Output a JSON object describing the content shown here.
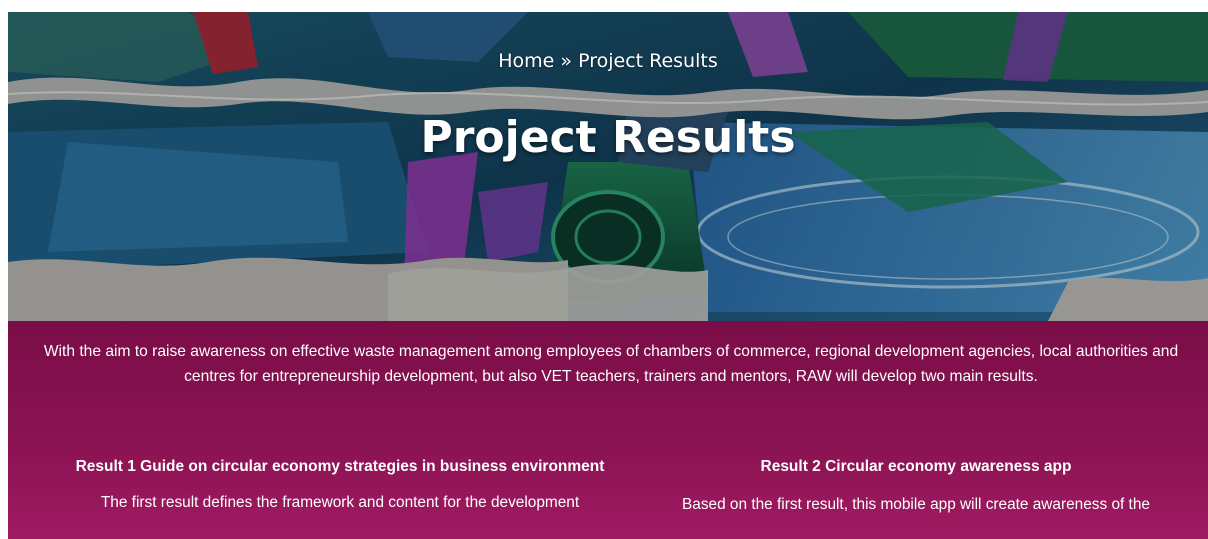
{
  "hero": {
    "breadcrumb": {
      "home": "Home",
      "separator": "»",
      "current": "Project Results"
    },
    "title": "Project Results"
  },
  "intro": "With the aim to raise awareness on effective waste management among employees of chambers of commerce, regional development agencies, local authorities and centres for entrepreneurship development, but also VET teachers, trainers and mentors, RAW will develop two main results.",
  "results": [
    {
      "title": "Result 1 Guide on circular economy strategies in business environment",
      "text": "The first result defines the framework and content for the development"
    },
    {
      "title": "Result 2 Circular economy awareness app",
      "text": "Based on the first result, this mobile app will create awareness of the"
    }
  ],
  "colors": {
    "content_background": "#8a1352",
    "hero_base": "#0f3b56",
    "text": "#ffffff"
  }
}
